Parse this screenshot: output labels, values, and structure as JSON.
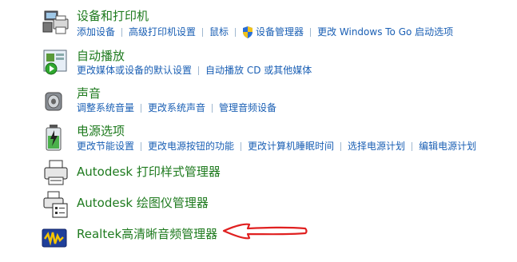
{
  "items": [
    {
      "title": "设备和打印机",
      "links": [
        "添加设备",
        "高级打印机设置",
        "鼠标",
        "设备管理器",
        "更改 Windows To Go 启动选项"
      ]
    },
    {
      "title": "自动播放",
      "links": [
        "更改媒体或设备的默认设置",
        "自动播放 CD 或其他媒体"
      ]
    },
    {
      "title": "声音",
      "links": [
        "调整系统音量",
        "更改系统声音",
        "管理音频设备"
      ]
    },
    {
      "title": "电源选项",
      "links": [
        "更改节能设置",
        "更改电源按钮的功能",
        "更改计算机睡眠时间",
        "选择电源计划",
        "编辑电源计划"
      ]
    },
    {
      "title": "Autodesk 打印样式管理器"
    },
    {
      "title": "Autodesk 绘图仪管理器"
    },
    {
      "title": "Realtek高清晰音频管理器"
    }
  ],
  "icons": [
    "printer-devices-icon",
    "autoplay-icon",
    "speaker-icon",
    "battery-power-icon",
    "print-style-manager-icon",
    "plotter-manager-icon",
    "realtek-audio-icon",
    "uac-shield-icon",
    "red-arrow-annotation"
  ],
  "colors": {
    "title": "#1e7a1e",
    "link": "#1a5fb4",
    "arrow": "#e02020"
  }
}
